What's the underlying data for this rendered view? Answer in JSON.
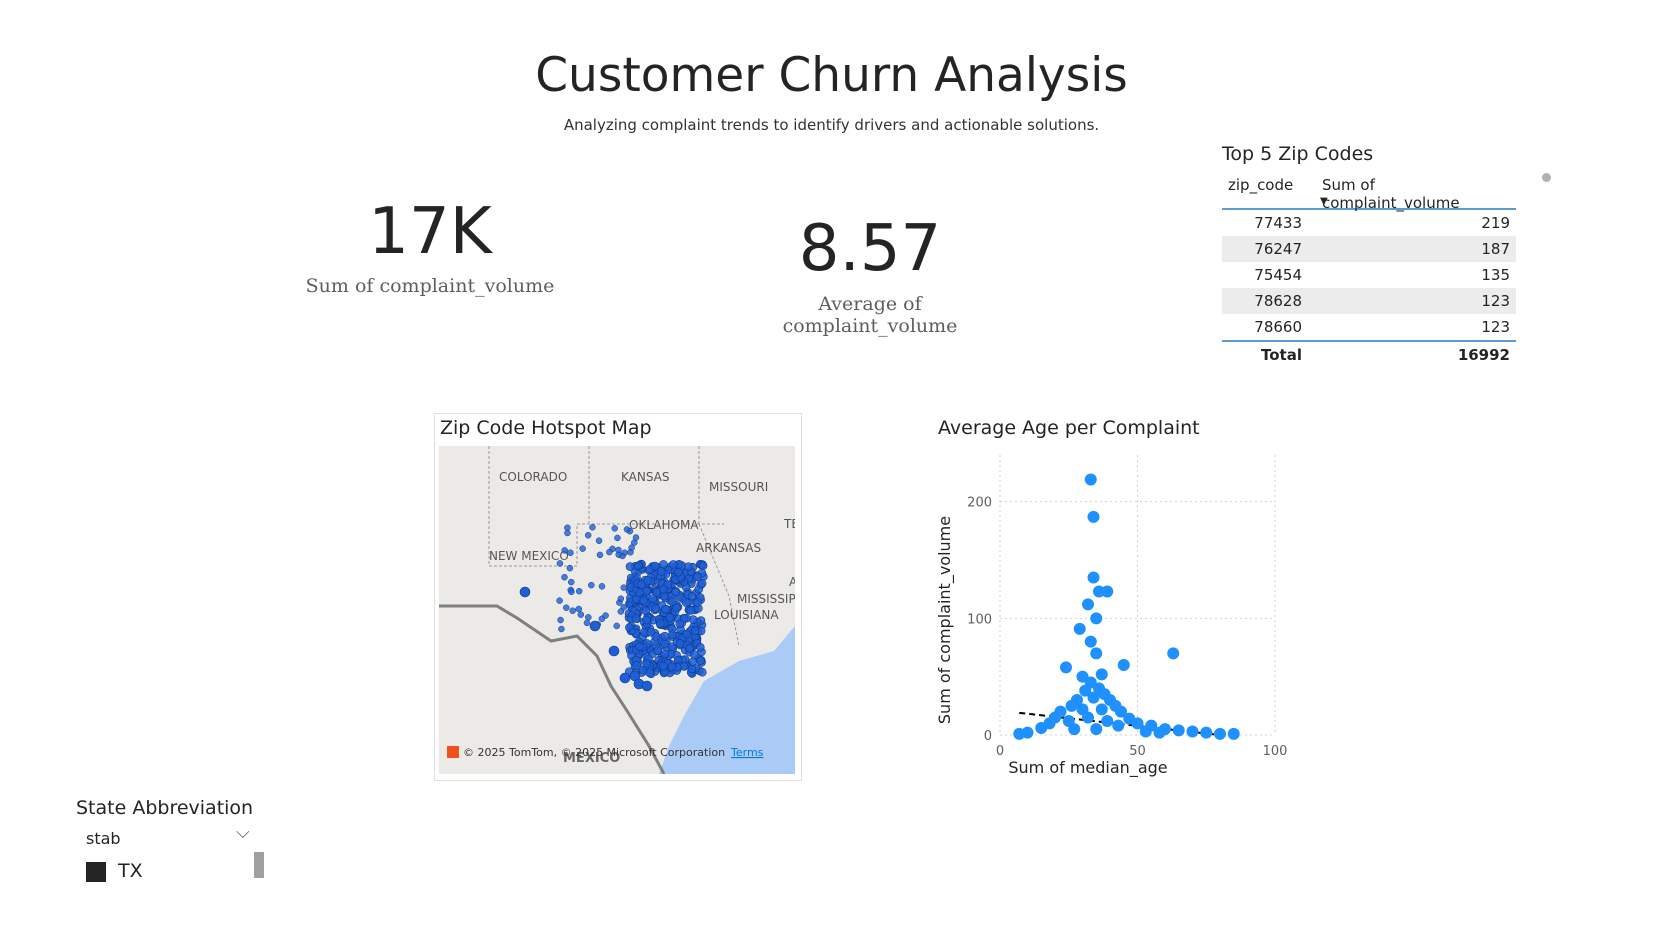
{
  "header": {
    "title": "Customer Churn Analysis",
    "subtitle": "Analyzing complaint trends to identify drivers and actionable solutions."
  },
  "cards": [
    {
      "value": "17K",
      "label": "Sum of complaint_volume"
    },
    {
      "value": "8.57",
      "label": "Average of complaint_volume"
    }
  ],
  "top_zip": {
    "title": "Top 5 Zip Codes",
    "columns": [
      "zip_code",
      "Sum of complaint_volume"
    ],
    "sort_icon": "sort-descending-icon",
    "rows": [
      {
        "zip": "77433",
        "value": "219"
      },
      {
        "zip": "76247",
        "value": "187"
      },
      {
        "zip": "75454",
        "value": "135"
      },
      {
        "zip": "78628",
        "value": "123"
      },
      {
        "zip": "78660",
        "value": "123"
      }
    ],
    "total_label": "Total",
    "total_value": "16992"
  },
  "map": {
    "title": "Zip Code Hotspot Map",
    "labels": [
      "COLORADO",
      "KANSAS",
      "MISSOURI",
      "OKLAHOMA",
      "ARKANSAS",
      "NEW MEXICO",
      "MISSISSIPPI",
      "LOUISIANA",
      "TE",
      "A",
      "MEXICO"
    ],
    "attribution": "© 2025 TomTom, © 2025 Microsoft Corporation",
    "terms": "Terms",
    "point_color": "#1f5fd6"
  },
  "chart_data": {
    "type": "scatter",
    "title": "Average Age per Complaint",
    "xlabel": "Sum of median_age",
    "ylabel": "Sum of complaint_volume",
    "xlim": [
      0,
      100
    ],
    "ylim": [
      0,
      240
    ],
    "xticks": [
      "0",
      "50",
      "100"
    ],
    "yticks": [
      "0",
      "100",
      "200"
    ],
    "grid": true,
    "color": "#1e90ff",
    "trend_line": {
      "style": "dashed",
      "x": [
        7,
        80
      ],
      "y": [
        19,
        0
      ]
    },
    "points": [
      {
        "x": 33,
        "y": 219
      },
      {
        "x": 34,
        "y": 187
      },
      {
        "x": 34,
        "y": 135
      },
      {
        "x": 39,
        "y": 123
      },
      {
        "x": 36,
        "y": 123
      },
      {
        "x": 32,
        "y": 112
      },
      {
        "x": 29,
        "y": 91
      },
      {
        "x": 35,
        "y": 100
      },
      {
        "x": 63,
        "y": 70
      },
      {
        "x": 24,
        "y": 58
      },
      {
        "x": 45,
        "y": 60
      },
      {
        "x": 33,
        "y": 80
      },
      {
        "x": 35,
        "y": 70
      },
      {
        "x": 30,
        "y": 50
      },
      {
        "x": 37,
        "y": 52
      },
      {
        "x": 33,
        "y": 45
      },
      {
        "x": 36,
        "y": 40
      },
      {
        "x": 31,
        "y": 38
      },
      {
        "x": 38,
        "y": 35
      },
      {
        "x": 28,
        "y": 30
      },
      {
        "x": 40,
        "y": 30
      },
      {
        "x": 34,
        "y": 32
      },
      {
        "x": 26,
        "y": 25
      },
      {
        "x": 42,
        "y": 25
      },
      {
        "x": 22,
        "y": 20
      },
      {
        "x": 44,
        "y": 20
      },
      {
        "x": 30,
        "y": 22
      },
      {
        "x": 37,
        "y": 22
      },
      {
        "x": 20,
        "y": 15
      },
      {
        "x": 47,
        "y": 14
      },
      {
        "x": 18,
        "y": 10
      },
      {
        "x": 50,
        "y": 10
      },
      {
        "x": 55,
        "y": 8
      },
      {
        "x": 15,
        "y": 6
      },
      {
        "x": 60,
        "y": 5
      },
      {
        "x": 65,
        "y": 4
      },
      {
        "x": 70,
        "y": 3
      },
      {
        "x": 75,
        "y": 2
      },
      {
        "x": 80,
        "y": 1
      },
      {
        "x": 85,
        "y": 1
      },
      {
        "x": 10,
        "y": 2
      },
      {
        "x": 7,
        "y": 1
      },
      {
        "x": 25,
        "y": 12
      },
      {
        "x": 32,
        "y": 15
      },
      {
        "x": 39,
        "y": 12
      },
      {
        "x": 43,
        "y": 8
      },
      {
        "x": 27,
        "y": 5
      },
      {
        "x": 53,
        "y": 3
      },
      {
        "x": 58,
        "y": 2
      },
      {
        "x": 35,
        "y": 5
      }
    ]
  },
  "slicer": {
    "title": "State Abbreviation",
    "field": "stab",
    "option": "TX",
    "option_checked": true
  }
}
